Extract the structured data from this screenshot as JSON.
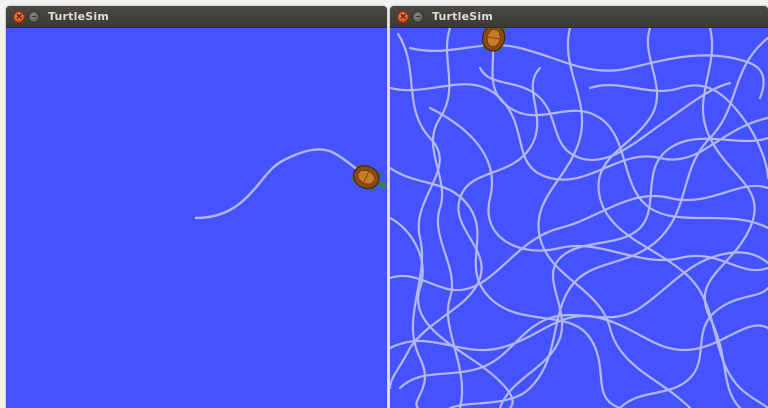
{
  "windows": [
    {
      "title": "TurtleSim",
      "close_glyph": "×",
      "minimize_glyph": "–",
      "background_color": "#4453ff",
      "pen_color": "#b3b8f0",
      "icons": [
        "close-icon",
        "minimize-icon",
        "turtle-icon"
      ]
    },
    {
      "title": "TurtleSim",
      "close_glyph": "×",
      "minimize_glyph": "–",
      "background_color": "#4453ff",
      "pen_color": "#b3b8f0",
      "icons": [
        "close-icon",
        "minimize-icon",
        "turtle-icon"
      ]
    }
  ]
}
